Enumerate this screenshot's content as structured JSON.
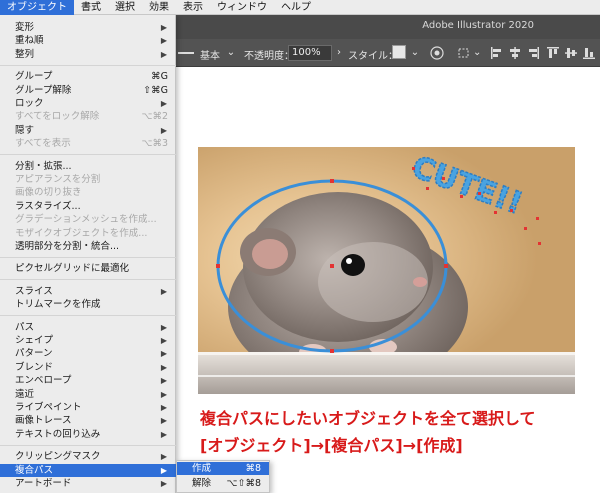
{
  "menubar": {
    "items": [
      "オブジェクト",
      "書式",
      "選択",
      "効果",
      "表示",
      "ウィンドウ",
      "ヘルプ"
    ],
    "active_index": 0
  },
  "app": {
    "title": "Adobe Illustrator 2020"
  },
  "control_bar": {
    "stroke_profile": "基本",
    "opacity_label": "不透明度：",
    "opacity_value": "100%",
    "style_label": "スタイル："
  },
  "object_menu": {
    "groups": [
      [
        {
          "label": "変形",
          "submenu": true
        },
        {
          "label": "重ね順",
          "submenu": true
        },
        {
          "label": "整列",
          "submenu": true
        }
      ],
      [
        {
          "label": "グループ",
          "shortcut": "⌘G"
        },
        {
          "label": "グループ解除",
          "shortcut": "⇧⌘G"
        },
        {
          "label": "ロック",
          "submenu": true
        },
        {
          "label": "すべてをロック解除",
          "shortcut": "⌥⌘2",
          "disabled": true
        },
        {
          "label": "隠す",
          "submenu": true
        },
        {
          "label": "すべてを表示",
          "shortcut": "⌥⌘3",
          "disabled": true
        }
      ],
      [
        {
          "label": "分割・拡張..."
        },
        {
          "label": "アピアランスを分割",
          "disabled": true
        },
        {
          "label": "画像の切り抜き",
          "disabled": true
        },
        {
          "label": "ラスタライズ..."
        },
        {
          "label": "グラデーションメッシュを作成...",
          "disabled": true
        },
        {
          "label": "モザイクオブジェクトを作成...",
          "disabled": true
        },
        {
          "label": "透明部分を分割・統合..."
        }
      ],
      [
        {
          "label": "ピクセルグリッドに最適化"
        }
      ],
      [
        {
          "label": "スライス",
          "submenu": true
        },
        {
          "label": "トリムマークを作成"
        }
      ],
      [
        {
          "label": "パス",
          "submenu": true
        },
        {
          "label": "シェイプ",
          "submenu": true
        },
        {
          "label": "パターン",
          "submenu": true
        },
        {
          "label": "ブレンド",
          "submenu": true
        },
        {
          "label": "エンベロープ",
          "submenu": true
        },
        {
          "label": "遠近",
          "submenu": true
        },
        {
          "label": "ライブペイント",
          "submenu": true
        },
        {
          "label": "画像トレース",
          "submenu": true
        },
        {
          "label": "テキストの回り込み",
          "submenu": true
        }
      ],
      [
        {
          "label": "クリッピングマスク",
          "submenu": true
        },
        {
          "label": "複合パス",
          "submenu": true,
          "selected": true
        },
        {
          "label": "アートボード",
          "submenu": true
        }
      ]
    ]
  },
  "compound_path_submenu": {
    "items": [
      {
        "label": "作成",
        "shortcut": "⌘8",
        "selected": true
      },
      {
        "label": "解除",
        "shortcut": "⌥⇧⌘8"
      }
    ]
  },
  "canvas": {
    "artwork_text": "CUTE!!",
    "caption_line1": "複合パスにしたいオブジェクトを全て選択して",
    "caption_line2": "[オブジェクト]→[複合パス]→[作成]"
  },
  "colors": {
    "selection_accent": "#2f6fd8",
    "path_stroke": "#3a8fd8",
    "anchor_point": "#e33333",
    "caption_text": "#d81a1a"
  }
}
